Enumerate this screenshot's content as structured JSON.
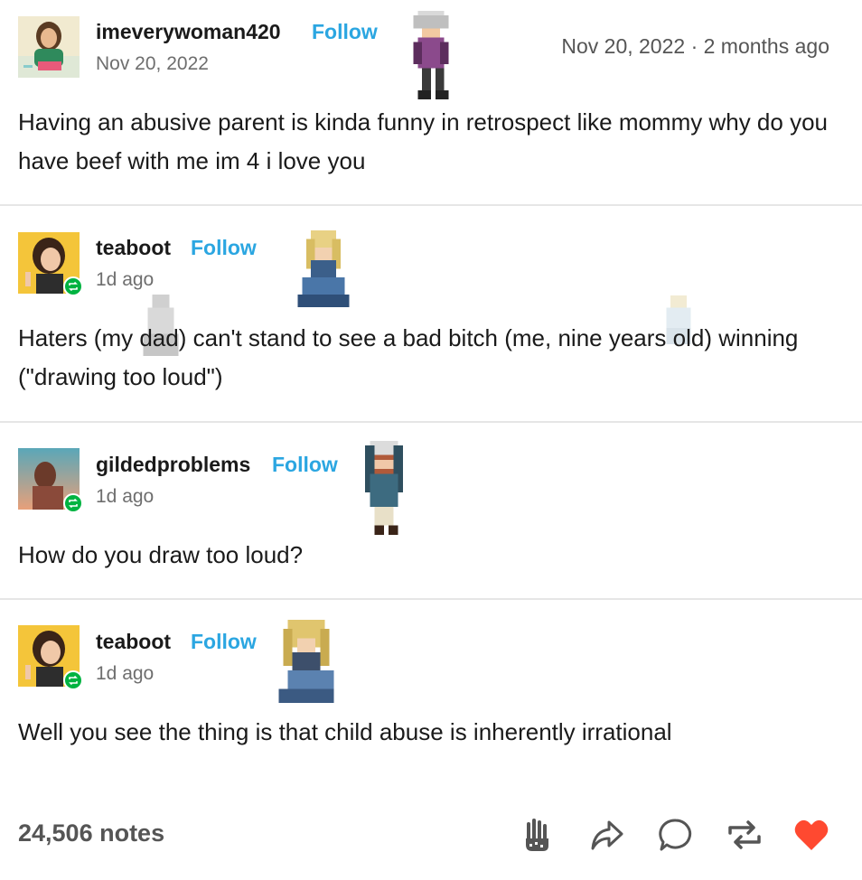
{
  "posts": [
    {
      "username": "imeverywoman420",
      "follow": "Follow",
      "date": "Nov 20, 2022",
      "top_date": "Nov 20, 2022 · 2 months ago",
      "text": "Having an abusive parent is kinda funny in retrospect like mommy why do you have beef with me im 4 i love you"
    },
    {
      "username": "teaboot",
      "follow": "Follow",
      "date": "1d ago",
      "text": "Haters (my dad) can't stand to see a bad bitch (me, nine years old) winning (\"drawing too loud\")"
    },
    {
      "username": "gildedproblems",
      "follow": "Follow",
      "date": "1d ago",
      "text": "How do you draw too loud?"
    },
    {
      "username": "teaboot",
      "follow": "Follow",
      "date": "1d ago",
      "text": "Well you see the thing is that child abuse is inherently irrational"
    }
  ],
  "footer": {
    "notes": "24,506 notes",
    "actions": [
      "hand-icon",
      "share-icon",
      "comment-icon",
      "reblog-icon",
      "like-icon"
    ],
    "like_color": "#ff4930"
  },
  "colors": {
    "follow": "#2ba6e1",
    "reblog_badge": "#00b341"
  }
}
